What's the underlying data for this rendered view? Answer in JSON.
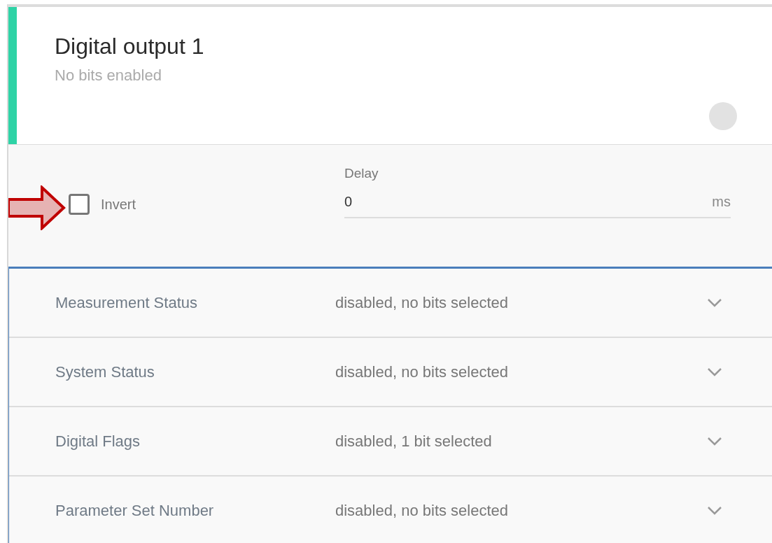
{
  "card": {
    "title": "Digital output 1",
    "subtitle": "No bits enabled"
  },
  "settings": {
    "invert": {
      "label": "Invert",
      "checked": false
    },
    "delay": {
      "label": "Delay",
      "value": "0",
      "unit": "ms"
    }
  },
  "sources": [
    {
      "label": "Measurement Status",
      "value": "disabled, no bits selected",
      "expanded": false
    },
    {
      "label": "System Status",
      "value": "disabled, no bits selected",
      "expanded": false
    },
    {
      "label": "Digital Flags",
      "value": "disabled, 1 bit selected",
      "expanded": false
    },
    {
      "label": "Parameter Set Number",
      "value": "disabled, no bits selected",
      "expanded": false
    }
  ]
}
